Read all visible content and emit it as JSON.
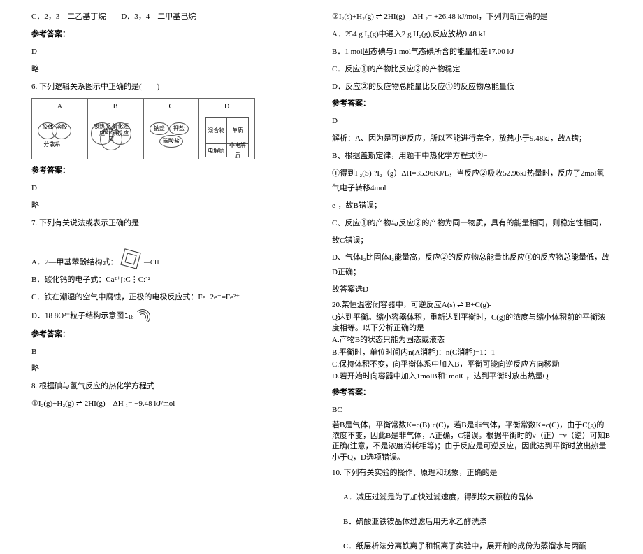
{
  "left": {
    "q5_cd": "C．2，3—二乙基丁烷　　D．3，4—二甲基己烷",
    "ans_label": "参考答案：",
    "ans5": "D",
    "lue": "略",
    "q6": "6. 下列逻辑关系图示中正确的是(　　)",
    "thA": "A",
    "thB": "B",
    "thC": "C",
    "thD": "D",
    "cellA1": "胶体",
    "cellA2": "溶胶",
    "cellA3": "分散系",
    "cellB1": "吸热反应",
    "cellB2": "氧化还原反应",
    "cellB3": "放热反应",
    "cellC1": "钠盐",
    "cellC2": "钾盐",
    "cellC3": "碳酸盐",
    "cellD1": "混合物",
    "cellD2": "单质",
    "cellD3": "电解质",
    "cellD4": "非电解质",
    "ans6": "D",
    "q7": "7. 下列有关说法或表示正确的是",
    "q7a_pre": "A．2—甲基苯酚结构式：",
    "q7a_sub": "—CH",
    "q7b": "B．碳化钙的电子式：Ca²⁺[:C⋮C:]²⁻",
    "q7c": "C．铁在潮湿的空气中腐蚀，正极的电极反应式：Fe−2e⁻=Fe²⁺",
    "q7d_pre": "D．18 8O²⁻粒子结构示意图：",
    "q7d_core": "+18",
    "ans7": "B",
    "q8": "8. 根据碘与氢气反应的热化学方程式",
    "q8eq1": "①I₂(g)+H₂(g) ⇌ 2HI(g)　ΔH ₁= −9.48 kJ/mol"
  },
  "right": {
    "q8eq2": "②I₂(s)+H₂(g) ⇌ 2HI(g)　ΔH ₂= +26.48 kJ/mol，下列判断正确的是",
    "q8a": "A．254 g I₂(g)中通入2 g H₂(g),反应放热9.48 kJ",
    "q8b": "B．1 mol固态碘与1 mol气态碘所含的能量相差17.00 kJ",
    "q8c": "C．反应①的产物比反应②的产物稳定",
    "q8d": "D．反应②的反应物总能量比反应①的反应物总能量低",
    "ans_label": "参考答案：",
    "ans8": "D",
    "exp8a": "解析：A、因为是可逆反应，所以不能进行完全，放热小于9.48kJ，故A错；",
    "exp8b1": "B、根据盖斯定律，用题干中热化学方程式②−",
    "exp8b2": "①得到I ₂(S) ?I₂（g）ΔH=35.96KJ/L，当反应②吸收52.96kJ热量时，反应了2mol氢气电子转移4mol",
    "exp8b3": "e-，故B错误；",
    "exp8c1": "C、反应①的产物与反应②的产物为同一物质，具有的能量相同，则稳定性相同，",
    "exp8c2": "故C错误；",
    "exp8d": "D、气体I₂比固体I₂能量高，反应②的反应物总能量比反应①的反应物总能量低，故D正确；",
    "exp8end": "故答案选D",
    "q20_1": "20.某恒温密闭容器中，可逆反应A(s) ⇌ B+C(g)-",
    "q20_2": "Q达到平衡。缩小容器体积，重新达到平衡时，C(g)的浓度与缩小体积前的平衡浓度相等。以下分析正确的是",
    "q20a": "A.产物B的状态只能为固态或液态",
    "q20b": "B.平衡时，单位时间内n(A消耗)：n(C消耗)=1：1",
    "q20c": "C.保持体积不变，向平衡体系中加入B，平衡可能向逆反应方向移动",
    "q20d": "D.若开始时向容器中加入1molB和1molC，达到平衡时放出热量Q",
    "ans20": "BC",
    "exp20": "若B是气体，平衡常数K=c(B)·c(C)，若B是非气体，平衡常数K=c(C)，由于C(g)的浓度不变，因此B是非气体，A正确，C错误。根据平衡时的ν（正）=ν（逆）可知B正确(注意，不是浓度消耗相等)；由于反应是可逆反应，因此达到平衡时放出热量小于Q，D选项错误。",
    "q10": "10. 下列有关实验的操作、原理和现象，正确的是",
    "q10a": "A．减压过滤是为了加快过滤速度，得到较大颗粒的晶体",
    "q10b": "B．硫酸亚铁铵晶体过滤后用无水乙醇洗涤",
    "q10c": "C．纸层析法分离铁离子和铜离子实验中，展开剂的成份为蒸馏水与丙酮"
  }
}
